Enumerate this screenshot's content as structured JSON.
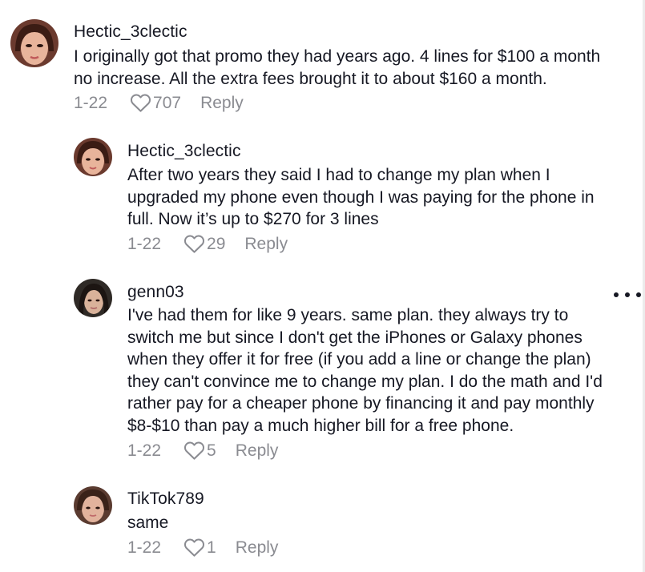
{
  "comments": [
    {
      "username": "Hectic_3clectic",
      "text": "I originally got that promo they had years ago. 4 lines for $100 a month\nno increase. All the extra fees brought it to about $160 a month.",
      "date": "1-22",
      "likes": "707",
      "reply_label": "Reply"
    },
    {
      "username": "Hectic_3clectic",
      "text": "After two years they said I had to change my plan when I\nupgraded my phone even though I was paying for the phone in\nfull. Now it’s up to $270 for 3 lines",
      "date": "1-22",
      "likes": "29",
      "reply_label": "Reply"
    },
    {
      "username": "genn03",
      "text": "I've had them for like 9 years. same plan. they always try to\nswitch me but since I don't get the iPhones or Galaxy phones\nwhen they offer it for free (if you add a line or change the plan)\nthey can't convince me to change my plan. I do the math and I'd\nrather pay for a cheaper phone by financing it and pay monthly\n$8-$10 than pay a much higher bill for a free phone.",
      "date": "1-22",
      "likes": "5",
      "reply_label": "Reply"
    },
    {
      "username": "TikTok789",
      "text": "same",
      "date": "1-22",
      "likes": "1",
      "reply_label": "Reply"
    }
  ],
  "icons": {
    "like": "heart-outline-icon",
    "more": "more-options-icon"
  },
  "colors": {
    "text": "#161823",
    "secondary": "#8a8b91",
    "background": "#ffffff"
  }
}
